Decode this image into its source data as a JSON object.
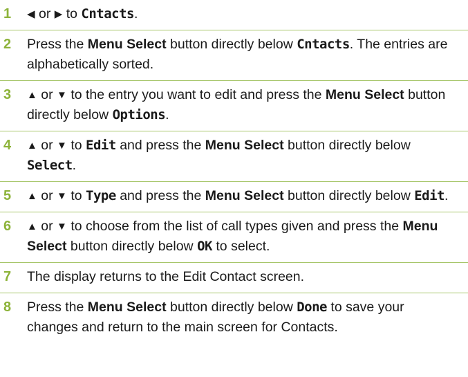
{
  "steps": [
    {
      "number": "1",
      "arrow_left": "◀",
      "or": "or",
      "arrow_right": "▶",
      "text": "to",
      "lcd": "Cntacts",
      "tail": "."
    },
    {
      "number": "2",
      "t1": "Press the",
      "b1": "Menu Select",
      "t2": "button directly below",
      "lcd": "Cntacts",
      "t3": ". The entries are alphabetically sorted."
    },
    {
      "number": "3",
      "arrow_up": "▲",
      "or": "or",
      "arrow_down": "▼",
      "t1": "to the entry you want to edit and press the",
      "b1": "Menu Select",
      "t2": "button directly below",
      "lcd": "Options",
      "t3": "."
    },
    {
      "number": "4",
      "arrow_up": "▲",
      "or": "or",
      "arrow_down": "▼",
      "t1": "to",
      "lcd1": "Edit",
      "t2": "and press the",
      "b1": "Menu Select",
      "t3": "button directly below",
      "lcd2": "Select",
      "t4": "."
    },
    {
      "number": "5",
      "arrow_up": "▲",
      "or": "or",
      "arrow_down": "▼",
      "t1": "to",
      "lcd1": "Type",
      "t2": "and press the",
      "b1": "Menu Select",
      "t3": "button directly below",
      "lcd2": "Edit",
      "t4": "."
    },
    {
      "number": "6",
      "arrow_up": "▲",
      "or": "or",
      "arrow_down": "▼",
      "t1": "to choose from the list of call types given and press the",
      "b1": "Menu Select",
      "t2": "button directly below",
      "lcd": "OK",
      "t3": "to select."
    },
    {
      "number": "7",
      "text": "The display returns to the Edit Contact screen."
    },
    {
      "number": "8",
      "t1": "Press the",
      "b1": "Menu Select",
      "t2": "button directly below",
      "lcd": "Done",
      "t3": "to save your changes and return to the main screen for Contacts."
    }
  ]
}
